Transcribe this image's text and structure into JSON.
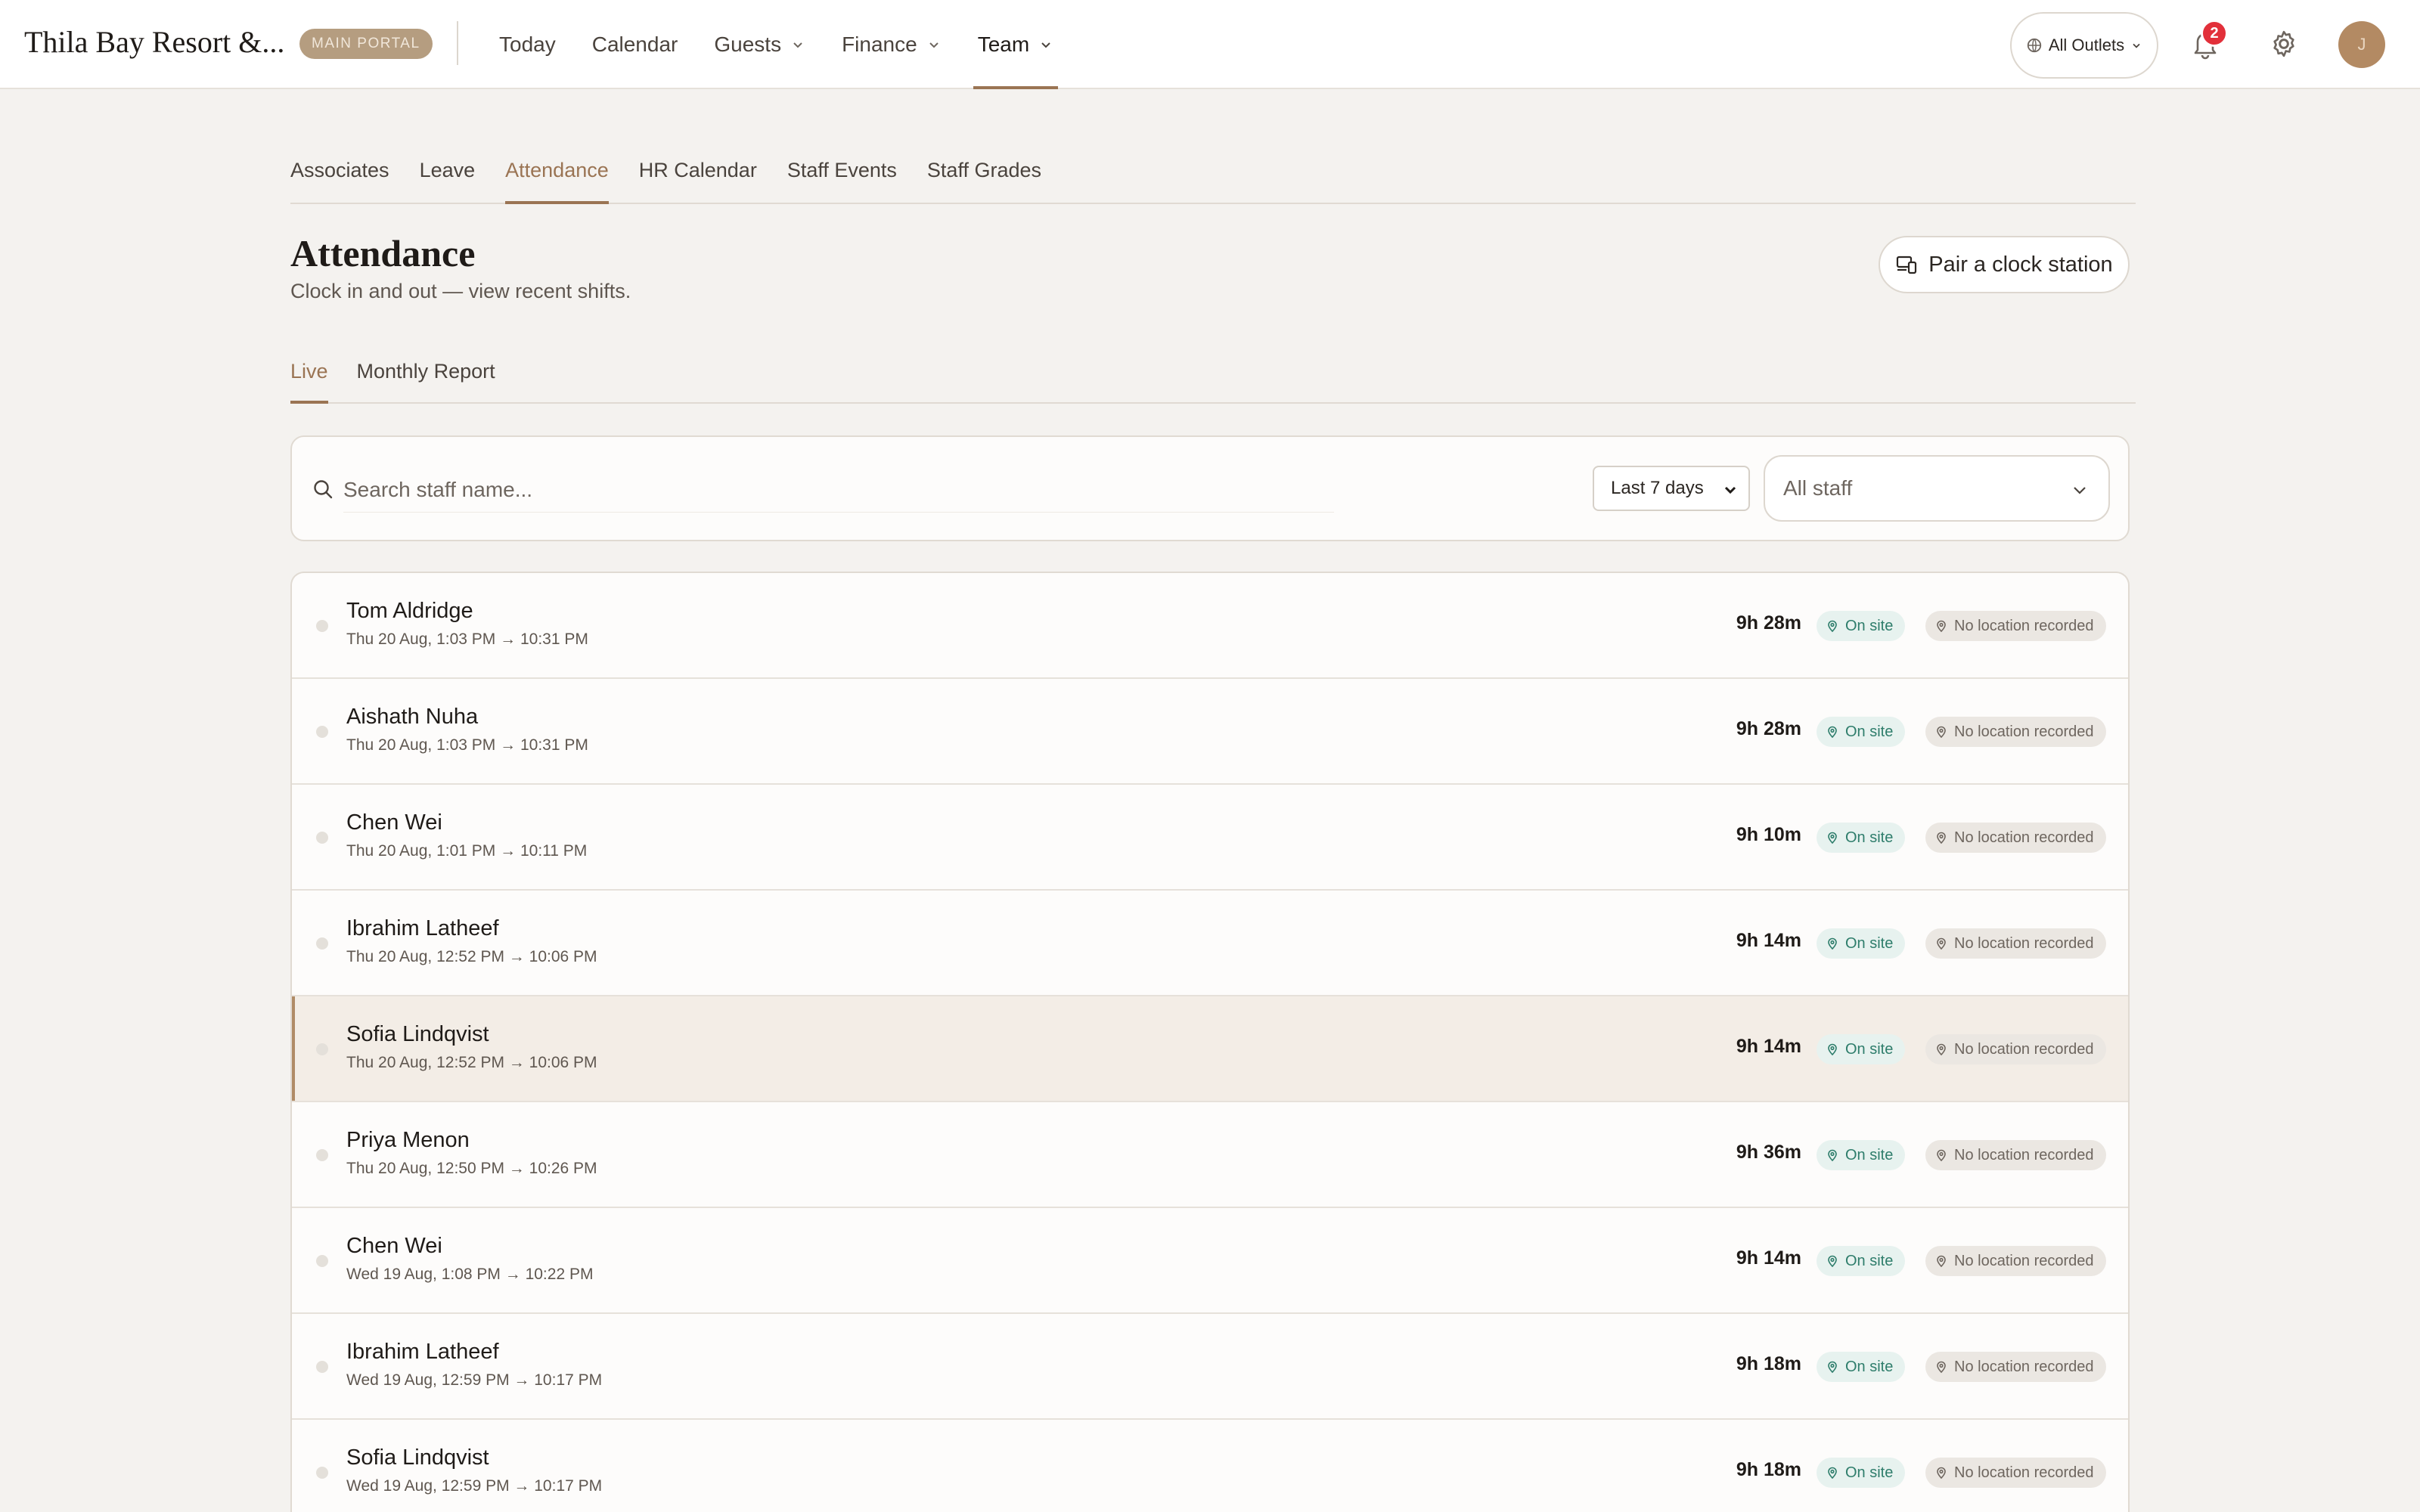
{
  "app": {
    "brand": "Thila Bay Resort &...",
    "portal_badge": "MAIN PORTAL"
  },
  "main_nav": [
    {
      "label": "Today",
      "has_menu": false,
      "active": false
    },
    {
      "label": "Calendar",
      "has_menu": false,
      "active": false
    },
    {
      "label": "Guests",
      "has_menu": true,
      "active": false
    },
    {
      "label": "Finance",
      "has_menu": true,
      "active": false
    },
    {
      "label": "Team",
      "has_menu": true,
      "active": true
    }
  ],
  "header": {
    "outlets_label": "All Outlets",
    "notification_count": "2",
    "avatar_initial": "J"
  },
  "sub_nav": [
    {
      "label": "Associates",
      "active": false
    },
    {
      "label": "Leave",
      "active": false
    },
    {
      "label": "Attendance",
      "active": true
    },
    {
      "label": "HR Calendar",
      "active": false
    },
    {
      "label": "Staff Events",
      "active": false
    },
    {
      "label": "Staff Grades",
      "active": false
    }
  ],
  "page": {
    "title": "Attendance",
    "subtitle": "Clock in and out — view recent shifts.",
    "pair_button": "Pair a clock station"
  },
  "inner_tabs": [
    {
      "label": "Live",
      "active": true
    },
    {
      "label": "Monthly Report",
      "active": false
    }
  ],
  "filters": {
    "search_placeholder": "Search staff name...",
    "range_value": "Last 7 days",
    "staff_value": "All staff"
  },
  "status": {
    "onsite_label": "On site",
    "location_label": "No location recorded"
  },
  "shifts": [
    {
      "name": "Tom Aldridge",
      "when": "Thu 20 Aug, 1:03 PM → 10:31 PM",
      "duration": "9h 28m",
      "selected": false
    },
    {
      "name": "Aishath Nuha",
      "when": "Thu 20 Aug, 1:03 PM → 10:31 PM",
      "duration": "9h 28m",
      "selected": false
    },
    {
      "name": "Chen Wei",
      "when": "Thu 20 Aug, 1:01 PM → 10:11 PM",
      "duration": "9h 10m",
      "selected": false
    },
    {
      "name": "Ibrahim Latheef",
      "when": "Thu 20 Aug, 12:52 PM → 10:06 PM",
      "duration": "9h 14m",
      "selected": false
    },
    {
      "name": "Sofia Lindqvist",
      "when": "Thu 20 Aug, 12:52 PM → 10:06 PM",
      "duration": "9h 14m",
      "selected": true
    },
    {
      "name": "Priya Menon",
      "when": "Thu 20 Aug, 12:50 PM → 10:26 PM",
      "duration": "9h 36m",
      "selected": false
    },
    {
      "name": "Chen Wei",
      "when": "Wed 19 Aug, 1:08 PM → 10:22 PM",
      "duration": "9h 14m",
      "selected": false
    },
    {
      "name": "Ibrahim Latheef",
      "when": "Wed 19 Aug, 12:59 PM → 10:17 PM",
      "duration": "9h 18m",
      "selected": false
    },
    {
      "name": "Sofia Lindqvist",
      "when": "Wed 19 Aug, 12:59 PM → 10:17 PM",
      "duration": "9h 18m",
      "selected": false
    }
  ],
  "colors": {
    "accent": "#9a7453",
    "onsite_text": "#2e7d6b",
    "notification": "#e2303a"
  }
}
